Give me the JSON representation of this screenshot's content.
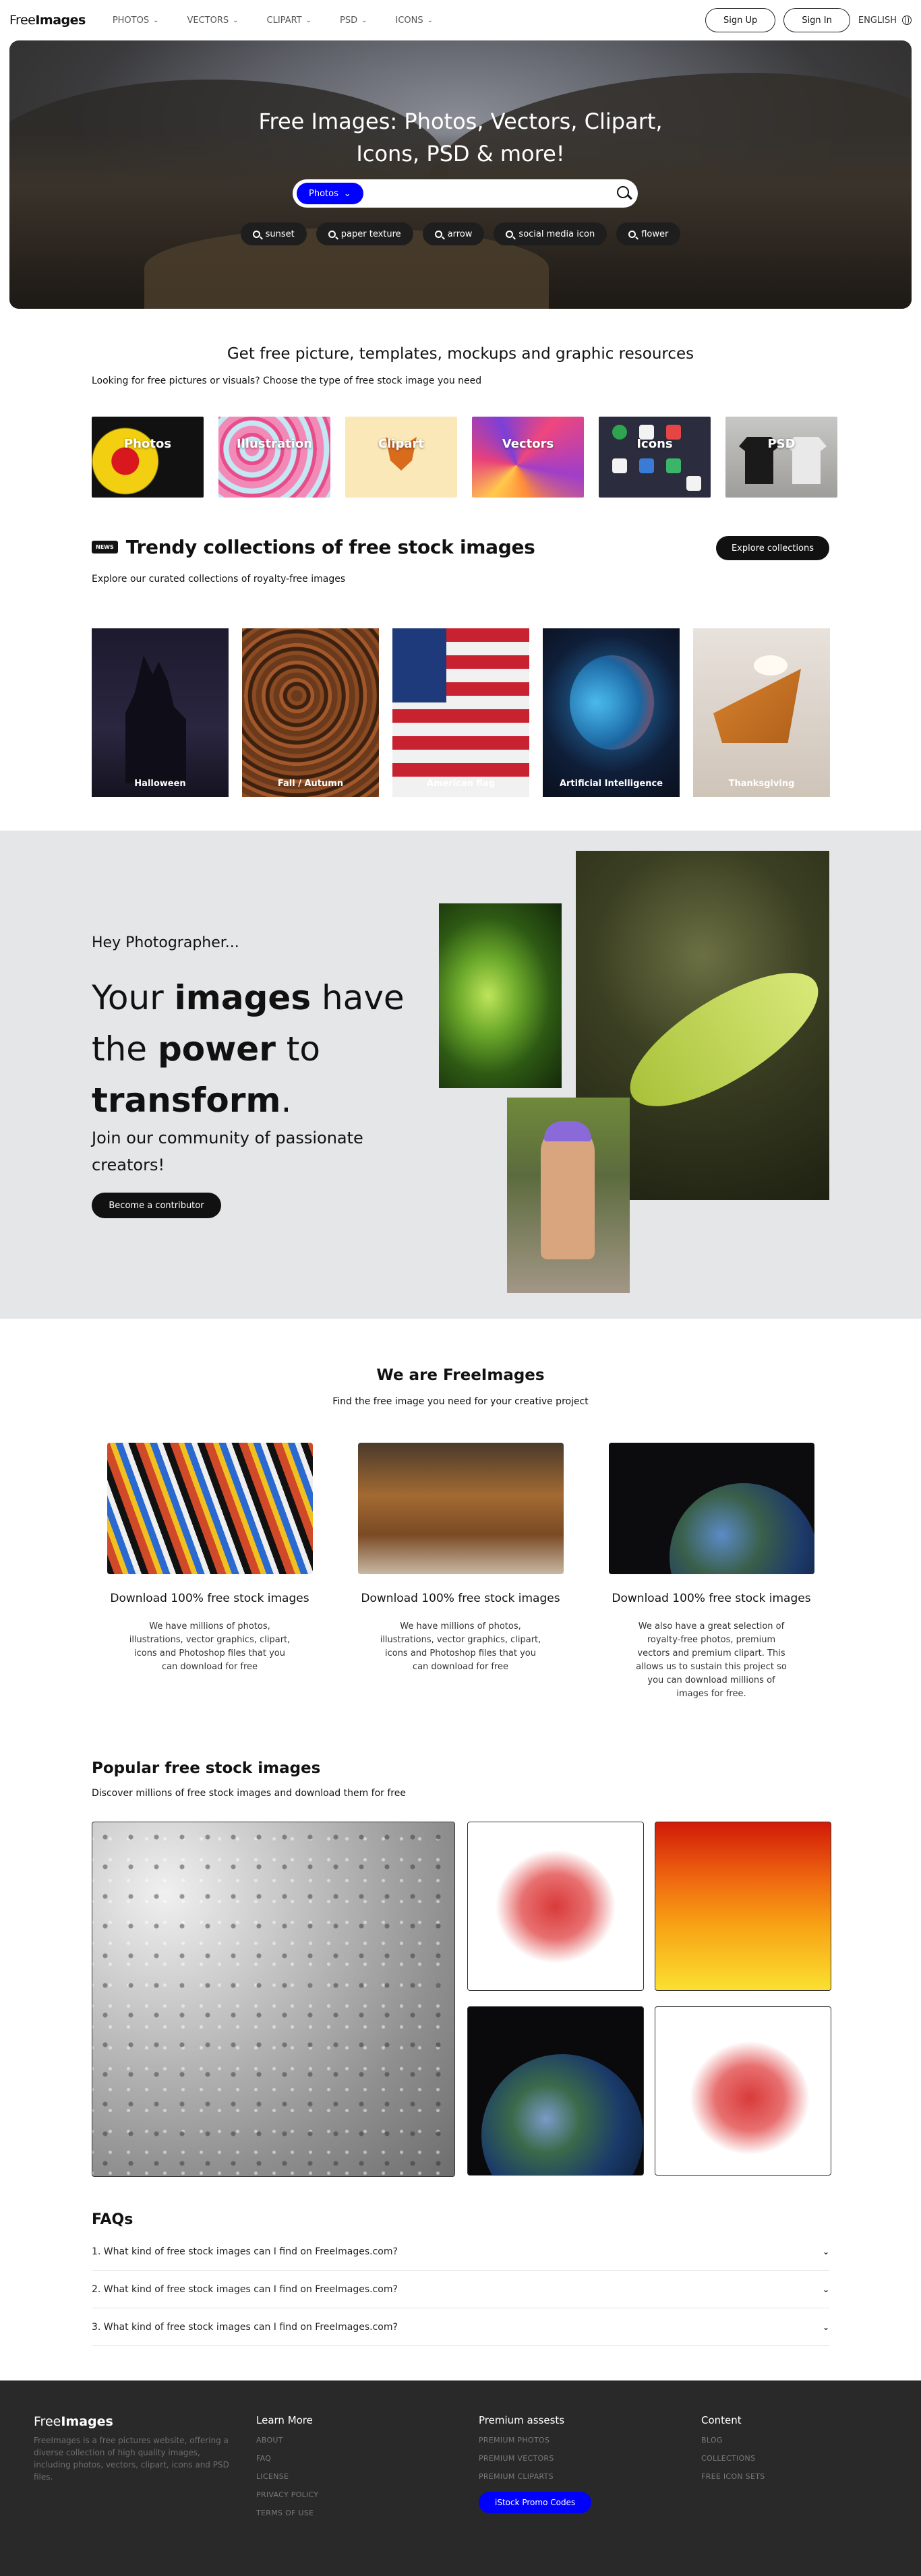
{
  "nav": {
    "logo_light": "Free",
    "logo_bold": "Images",
    "menu": [
      {
        "label": "PHOTOS"
      },
      {
        "label": "VECTORS"
      },
      {
        "label": "CLIPART"
      },
      {
        "label": "PSD"
      },
      {
        "label": "ICONS"
      }
    ],
    "sign_up": "Sign Up",
    "sign_in": "Sign In",
    "language": "ENGLISH"
  },
  "hero": {
    "title_line1": "Free Images: Photos, Vectors, Clipart,",
    "title_line2": "Icons, PSD & more!",
    "search_type": "Photos",
    "search_value": "",
    "chips": [
      "sunset",
      "paper texture",
      "arrow",
      "social media icon",
      "flower"
    ]
  },
  "resources": {
    "title": "Get free picture, templates, mockups and graphic resources",
    "subtitle": "Looking for free pictures or visuals? Choose the type of free stock image you need",
    "types": [
      "Photos",
      "Illustration",
      "Clipart",
      "Vectors",
      "Icons",
      "PSD"
    ]
  },
  "trendy": {
    "badge": "NEWS",
    "title": "Trendy collections of free stock images",
    "button": "Explore collections",
    "subtitle": "Explore our curated collections of royalty-free images",
    "collections": [
      "Halloween",
      "Fall / Autumn",
      "American flag",
      "Artificial Intelligence",
      "Thanksgiving"
    ]
  },
  "photographer": {
    "hey": "Hey Photographer...",
    "line1_a": "Your ",
    "line1_b": "images",
    "line1_c": " have",
    "line2_a": "the ",
    "line2_b": "power",
    "line2_c": " to",
    "line3_b": "transform",
    "line3_c": ".",
    "join": "Join our community of passionate creators!",
    "button": "Become a contributor"
  },
  "we_are": {
    "title": "We are FreeImages",
    "subtitle": "Find the free image you need for your creative project",
    "columns": [
      {
        "heading": "Download 100% free stock images",
        "text": "We have millions of photos, illustrations, vector graphics, clipart, icons and Photoshop files that you can download for free"
      },
      {
        "heading": "Download 100% free stock images",
        "text": "We have millions of photos, illustrations, vector graphics, clipart, icons and Photoshop files that you can download for free"
      },
      {
        "heading": "Download 100% free stock images",
        "text": "We also have a great selection of royalty-free photos, premium vectors and premium clipart. This allows us to sustain this project so you can download millions of images for free."
      }
    ]
  },
  "popular": {
    "title": "Popular free stock images",
    "subtitle": "Discover millions of free stock images and download them for free"
  },
  "faq": {
    "title": "FAQs",
    "items": [
      "1. What kind of free stock images can I find on FreeImages.com?",
      "2. What kind of free stock images can I find on FreeImages.com?",
      "3. What kind of free stock images can I find on FreeImages.com?"
    ]
  },
  "footer": {
    "logo_light": "Free",
    "logo_bold": "Images",
    "description": "FreeImages is a free pictures website, offering a diverse collection of high quality images, including photos, vectors, clipart, icons and PSD files.",
    "learn_more": {
      "heading": "Learn More",
      "links": [
        "ABOUT",
        "FAQ",
        "LICENSE",
        "PRIVACY POLICY",
        "TERMS OF USE"
      ]
    },
    "premium": {
      "heading": "Premium assests",
      "links": [
        "PREMIUM PHOTOS",
        "PREMIUM VECTORS",
        "PREMIUM CLIPARTS"
      ],
      "button": "iStock Promo Codes"
    },
    "content": {
      "heading": "Content",
      "links": [
        "BLOG",
        "COLLECTIONS",
        "FREE ICON SETS"
      ]
    }
  }
}
